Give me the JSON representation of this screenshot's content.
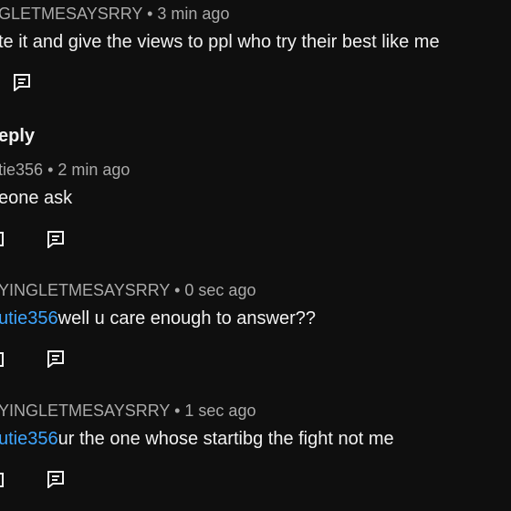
{
  "comments": [
    {
      "author": "GLETMESAYSRRY",
      "sep": "•",
      "time": "3 min ago",
      "text": "te it and give the views to ppl who try their best like me"
    },
    {
      "author": "tie356",
      "sep": "•",
      "time": "2 min ago",
      "text": "eone ask"
    },
    {
      "author": "YINGLETMESAYSRRY",
      "sep": "•",
      "time": "0 sec ago",
      "mention": "utie356",
      "text": "well u care enough to answer??"
    },
    {
      "author": "YINGLETMESAYSRRY",
      "sep": "•",
      "time": "1 sec ago",
      "mention": "utie356",
      "text": "ur the one whose startibg the fight not me"
    }
  ],
  "reply_header": "eply",
  "icons": {
    "comment": "comment-icon",
    "action_stub": "dislike-icon-partial"
  },
  "colors": {
    "background": "#0f0f0f",
    "text": "#f1f1f1",
    "meta": "#aaaaaa",
    "mention": "#3ea6ff"
  }
}
